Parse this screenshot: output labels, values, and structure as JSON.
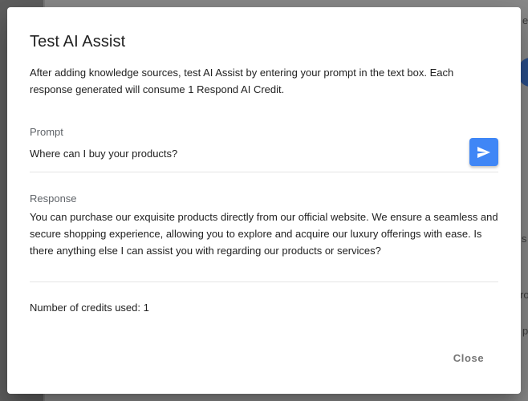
{
  "background": {
    "snippet_1": "er",
    "snippet_2": "is",
    "snippet_3": "ro",
    "snippet_4": "p"
  },
  "dialog": {
    "title": "Test AI Assist",
    "description": "After adding knowledge sources, test AI Assist by entering your prompt in the text box. Each response generated will consume 1 Respond AI Credit.",
    "prompt": {
      "label": "Prompt",
      "value": "Where can I buy your products?",
      "send_icon": "send-icon"
    },
    "response": {
      "label": "Response",
      "text": "You can purchase our exquisite products directly from our official website. We ensure a seamless and secure shopping experience, allowing you to explore and acquire our luxury offerings with ease. Is there anything else I can assist you with regarding our products or services?"
    },
    "credits_text": "Number of credits used: 1",
    "close_label": "Close"
  },
  "colors": {
    "accent": "#3f86f6",
    "overlay": "#5f5f5f",
    "text": "#212121",
    "muted": "#5f6368",
    "close": "#757575"
  }
}
